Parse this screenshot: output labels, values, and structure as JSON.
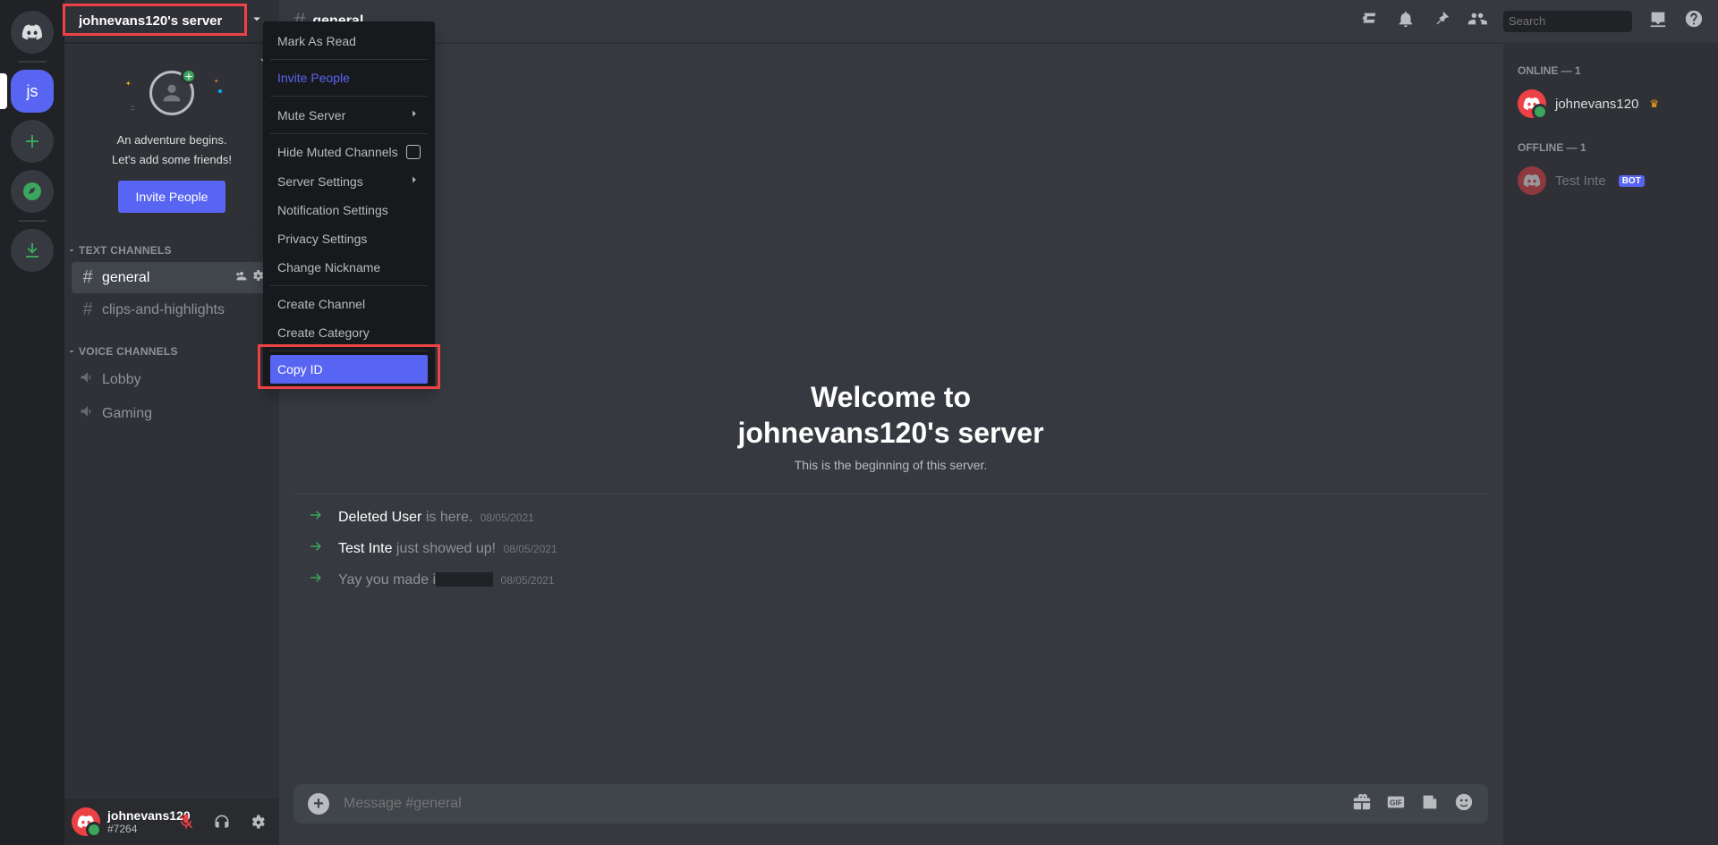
{
  "server": {
    "name": "johnevans120's server"
  },
  "welcome_card": {
    "line1": "An adventure begins.",
    "line2": "Let's add some friends!",
    "button": "Invite People"
  },
  "categories": [
    {
      "label": "TEXT CHANNELS"
    },
    {
      "label": "VOICE CHANNELS"
    }
  ],
  "text_channels": [
    {
      "name": "general",
      "selected": true
    },
    {
      "name": "clips-and-highlights"
    }
  ],
  "voice_channels": [
    {
      "name": "Lobby"
    },
    {
      "name": "Gaming"
    }
  ],
  "user_bar": {
    "name": "johnevans120",
    "tag": "#7264"
  },
  "ctx_menu": {
    "mark_read": "Mark As Read",
    "invite": "Invite People",
    "mute": "Mute Server",
    "hide_muted": "Hide Muted Channels",
    "server_settings": "Server Settings",
    "notif": "Notification Settings",
    "privacy": "Privacy Settings",
    "nick": "Change Nickname",
    "create_channel": "Create Channel",
    "create_category": "Create Category",
    "copy_id": "Copy ID"
  },
  "header": {
    "channel": "general",
    "search_placeholder": "Search"
  },
  "hero": {
    "line1": "Welcome to",
    "line2": "johnevans120's server",
    "sub": "This is the beginning of this server."
  },
  "sys_msgs": [
    {
      "b": "Deleted User",
      "text": " is here.",
      "date": "08/05/2021"
    },
    {
      "b": "Test Inte",
      "text": " just showed up!",
      "date": "08/05/2021"
    },
    {
      "pre": "Yay you made i",
      "redact": true,
      "date": "08/05/2021"
    }
  ],
  "composer": {
    "placeholder": "Message #general"
  },
  "members": {
    "online_hdr": "ONLINE — 1",
    "offline_hdr": "OFFLINE — 1",
    "online": [
      {
        "name": "johnevans120",
        "owner": true
      }
    ],
    "offline": [
      {
        "name": "Test Inte",
        "bot": true
      }
    ]
  },
  "pill_labels": {
    "selected": "js"
  }
}
